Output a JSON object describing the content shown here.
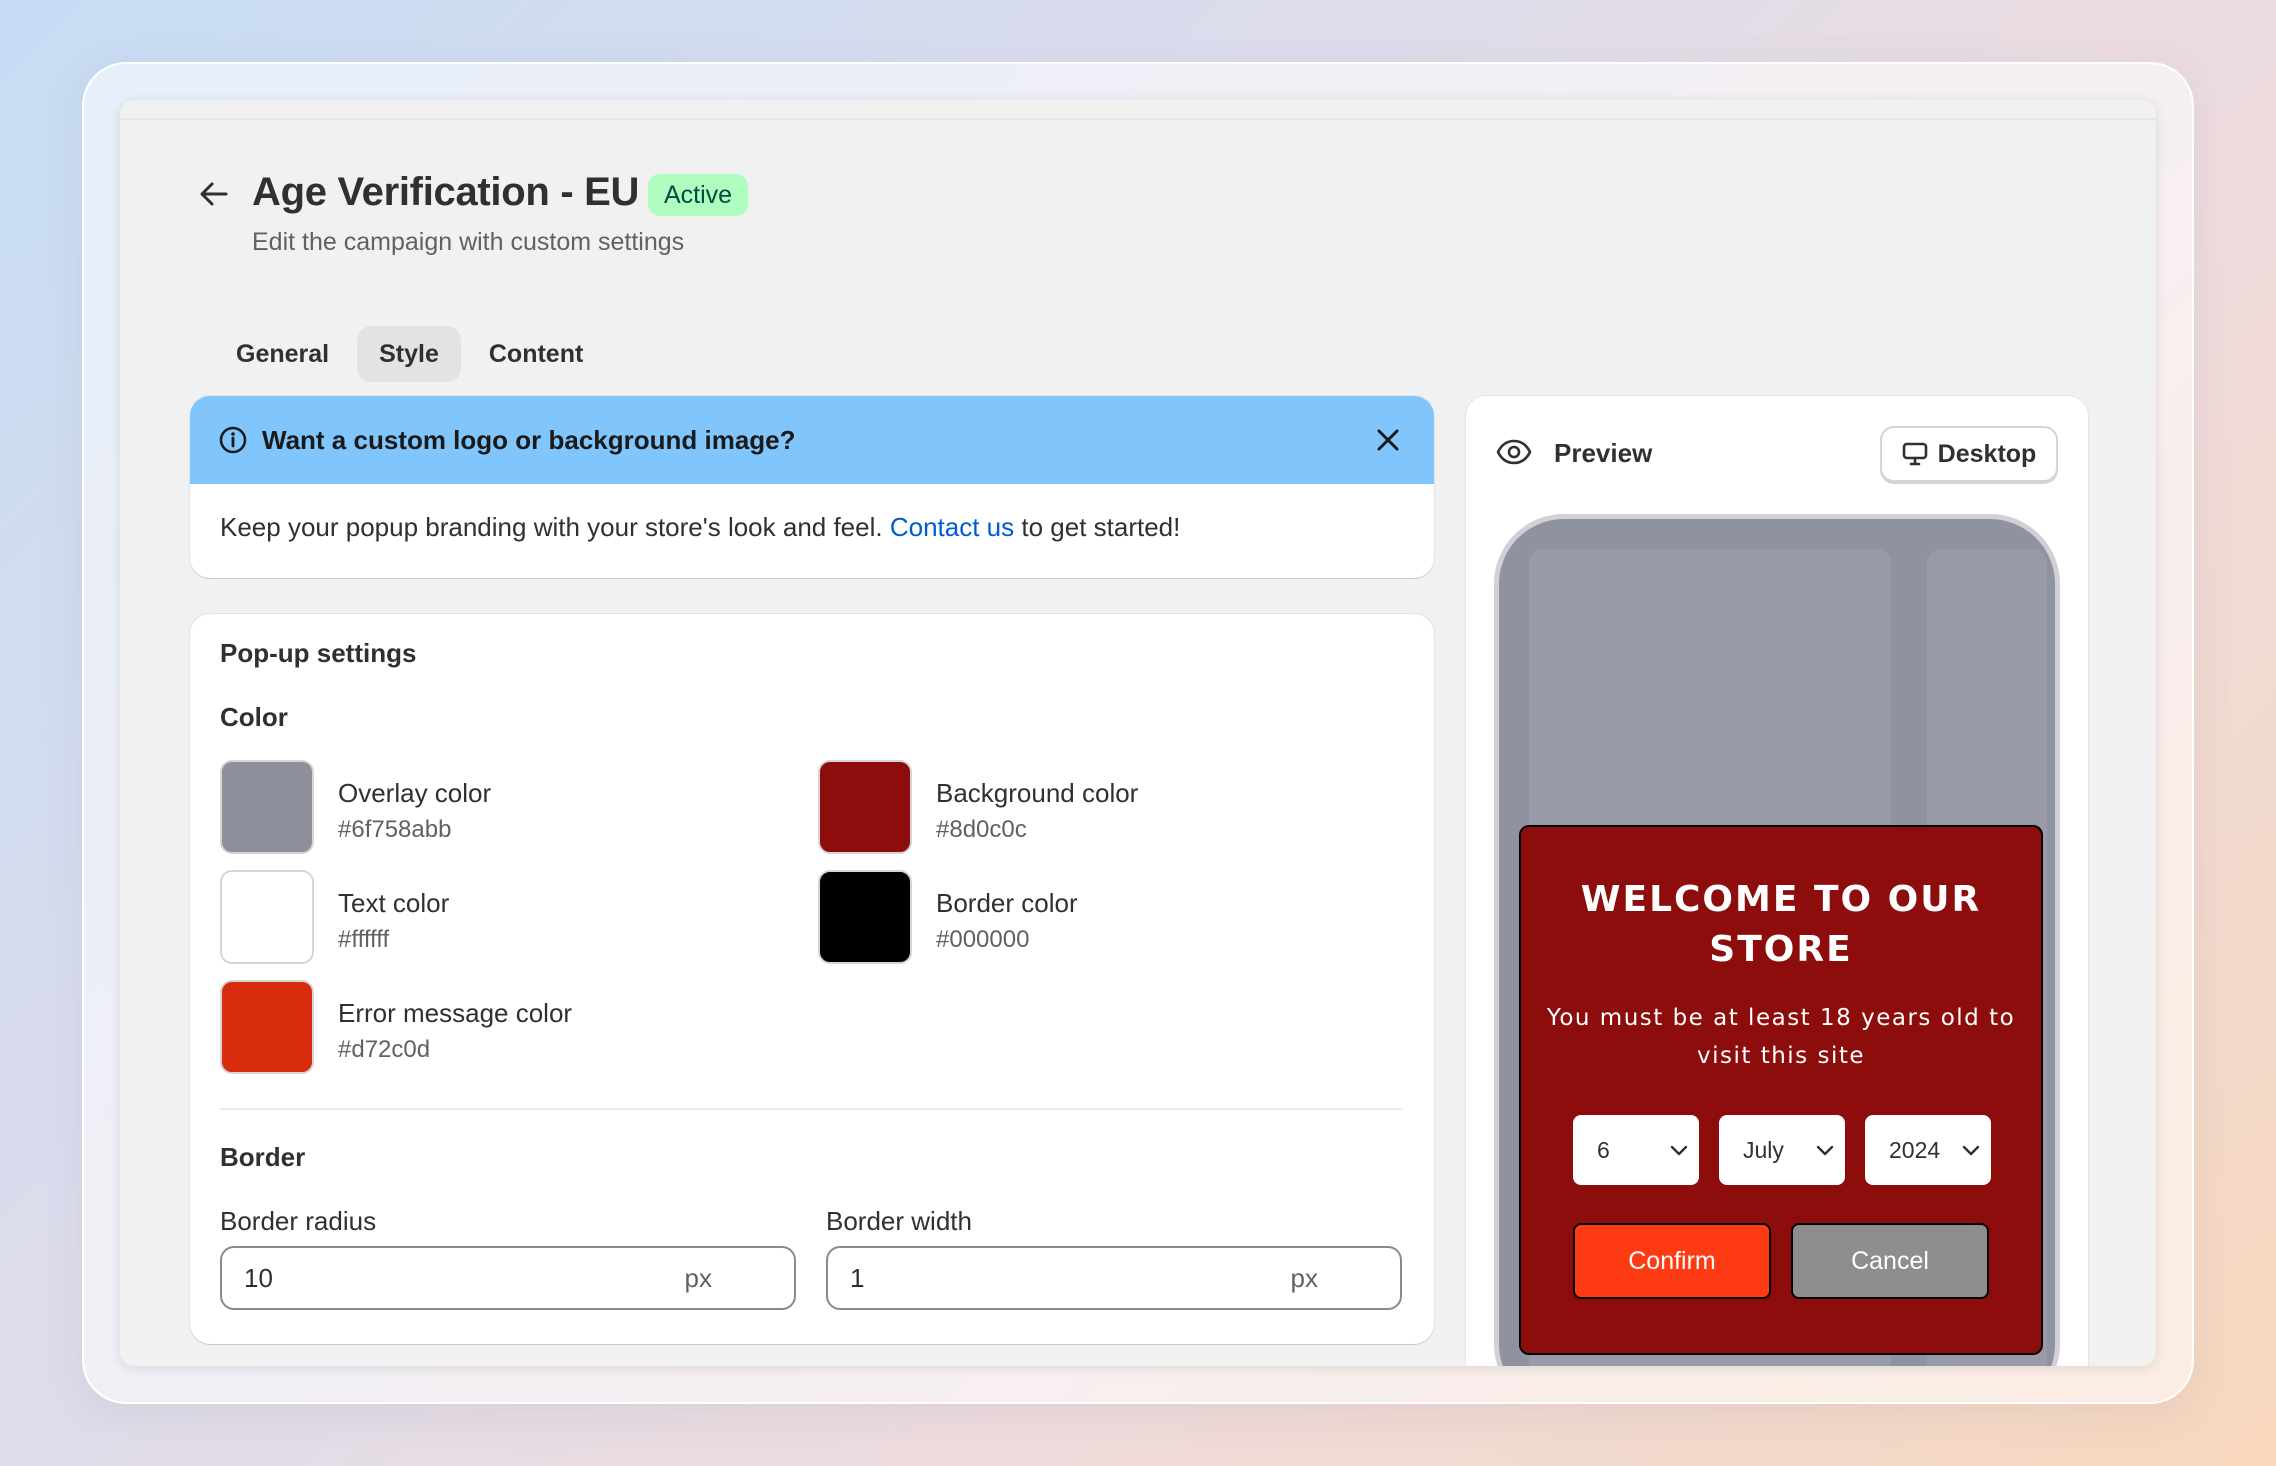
{
  "header": {
    "title": "Age Verification - EU",
    "status": "Active",
    "subtitle": "Edit the campaign with custom settings"
  },
  "tabs": [
    {
      "label": "General",
      "active": false
    },
    {
      "label": "Style",
      "active": true
    },
    {
      "label": "Content",
      "active": false
    }
  ],
  "banner": {
    "title": "Want a custom logo or background image?",
    "text_before": "Keep your popup branding with your store's look and feel. ",
    "link": "Contact us",
    "text_after": " to get started!"
  },
  "settings": {
    "title": "Pop-up settings",
    "color_heading": "Color",
    "colors": [
      {
        "label": "Overlay color",
        "value": "#6f758abb",
        "swatch": "#8d909c"
      },
      {
        "label": "Background color",
        "value": "#8d0c0c",
        "swatch": "#8d0c0c"
      },
      {
        "label": "Text color",
        "value": "#ffffff",
        "swatch": "#ffffff"
      },
      {
        "label": "Border color",
        "value": "#000000",
        "swatch": "#000000"
      },
      {
        "label": "Error message color",
        "value": "#d72c0d",
        "swatch": "#d72c0d"
      }
    ],
    "border_heading": "Border",
    "border_radius": {
      "label": "Border radius",
      "value": "10",
      "suffix": "px"
    },
    "border_width": {
      "label": "Border width",
      "value": "1",
      "suffix": "px"
    }
  },
  "preview": {
    "title": "Preview",
    "device": "Desktop",
    "popup": {
      "title": "WELCOME TO OUR STORE",
      "text": "You must be at least 18 years old to visit this site",
      "day": "6",
      "month": "July",
      "year": "2024",
      "confirm": "Confirm",
      "cancel": "Cancel"
    }
  },
  "colors": {
    "badge_bg": "#affebf",
    "banner_bg": "#80c5fb",
    "link": "#005bd3",
    "confirm_bg": "#ff3b14",
    "cancel_bg": "#8e8e8e"
  }
}
